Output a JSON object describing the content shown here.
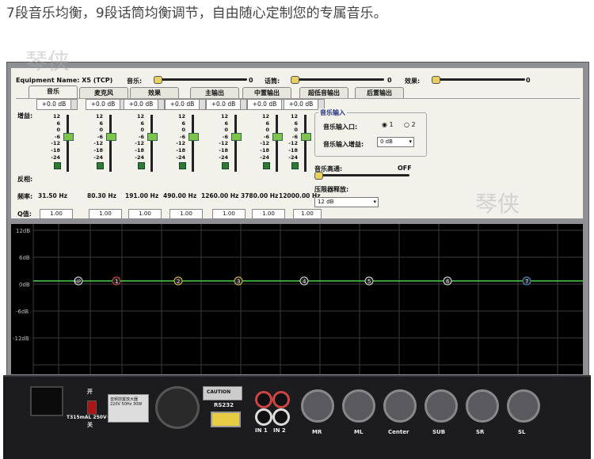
{
  "banner": "7段音乐均衡，9段话筒均衡调节，自由随心定制您的专属音乐。",
  "watermarks": [
    "琴侠",
    "琴侠"
  ],
  "app": {
    "equipment_label": "Equipment Name: X5 (TCP)",
    "top": {
      "music_label": "音乐:",
      "music_value": "0",
      "mic_label": "话筒:",
      "mic_value": "0",
      "effect_label": "效果:",
      "effect_value": "0"
    },
    "tabs": [
      "音乐",
      "麦克风",
      "效果",
      "主输出",
      "中置输出",
      "超低音输出",
      "后置输出"
    ],
    "row_labels": {
      "gain": "增益:",
      "inverse": "反相:",
      "freq": "频率:",
      "q": "Q值:"
    },
    "bands": [
      {
        "gain": "+0.0 dB",
        "freq": "31.50 Hz",
        "q": "1.00"
      },
      {
        "gain": "+0.0 dB",
        "freq": "80.30 Hz",
        "q": "1.00"
      },
      {
        "gain": "+0.0 dB",
        "freq": "191.00 Hz",
        "q": "1.00"
      },
      {
        "gain": "+0.0 dB",
        "freq": "490.00 Hz",
        "q": "1.00"
      },
      {
        "gain": "+0.0 dB",
        "freq": "1260.00 Hz",
        "q": "1.00"
      },
      {
        "gain": "+0.0 dB",
        "freq": "3780.00 Hz",
        "q": "1.00"
      },
      {
        "gain": "+0.0 dB",
        "freq": "12000.00 Hz",
        "q": "1.00"
      }
    ],
    "scale": [
      "12",
      "6",
      "0",
      "-6",
      "-12",
      "-18",
      "-24"
    ],
    "music_input": {
      "group_title": "音乐输入",
      "input_port_label": "音乐输入口:",
      "radio1": "1",
      "radio2": "2",
      "input_gain_label": "音乐输入增益:",
      "input_gain_value": "0 dB"
    },
    "highpass_label": "音乐高通:",
    "highpass_value": "OFF",
    "limiter_label": "压限器释放:",
    "limiter_value": "12 dB"
  },
  "graph": {
    "y_labels": [
      "12dB",
      "6dB",
      "0dB",
      "-6dB",
      "-12dB"
    ],
    "markers": [
      "HP",
      "1",
      "2",
      "3",
      "4",
      "5",
      "6",
      "7"
    ],
    "line_color": "#4cd24c"
  },
  "device": {
    "switch_on": "开",
    "switch_off": "关",
    "label_fuse": "T315mAL 250V~",
    "label_rs232": "RS232",
    "label_in1": "IN 1",
    "label_in2": "IN 2",
    "xlr_labels": [
      "MR",
      "ML",
      "Center",
      "SUB",
      "SR",
      "SL"
    ],
    "caution": "CAUTION",
    "plate": "音频前置放大器 220V 50Hz 30W"
  }
}
